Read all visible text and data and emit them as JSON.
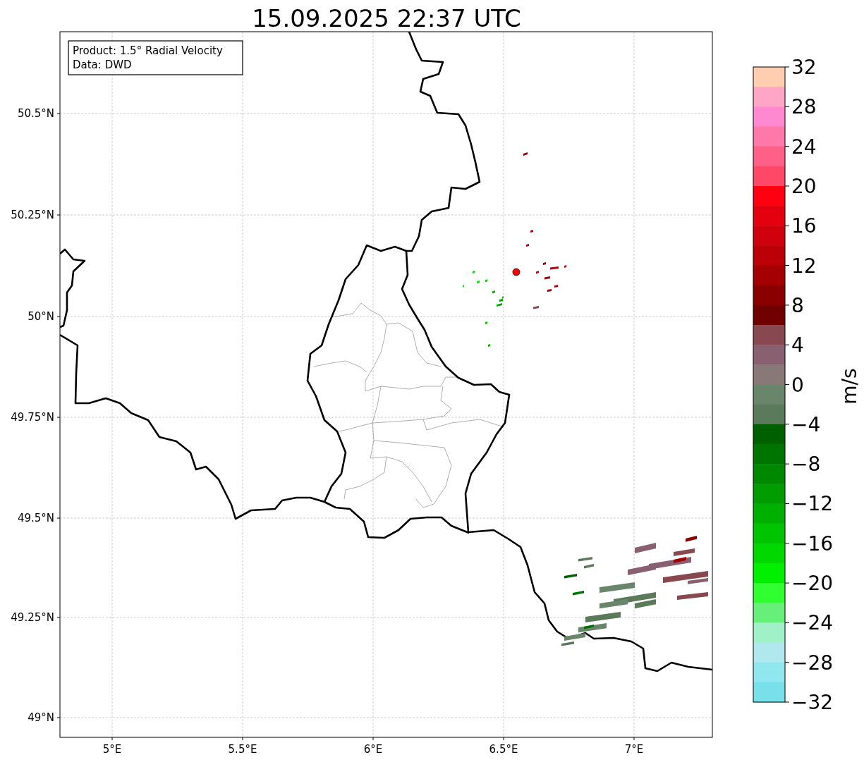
{
  "title": "15.09.2025 22:37 UTC",
  "legend": [
    "Product: 1.5° Radial Velocity",
    "Data: DWD"
  ],
  "y_ticks": [
    "50.5°N",
    "50.25°N",
    "50°N",
    "49.75°N",
    "49.5°N",
    "49.25°N",
    "49°N"
  ],
  "x_ticks": [
    "5°E",
    "5.5°E",
    "6°E",
    "6.5°E",
    "7°E"
  ],
  "colorbar": {
    "label": "m/s",
    "ticks": [
      "32",
      "28",
      "24",
      "20",
      "16",
      "12",
      "8",
      "4",
      "0",
      "−4",
      "−8",
      "−12",
      "−16",
      "−20",
      "−24",
      "−28",
      "−32"
    ],
    "bands": [
      {
        "color": "#ffcdb0"
      },
      {
        "color": "#ffa6c6"
      },
      {
        "color": "#ff88d0"
      },
      {
        "color": "#ff78a8"
      },
      {
        "color": "#ff6088"
      },
      {
        "color": "#ff4868"
      },
      {
        "color": "#ff0010"
      },
      {
        "color": "#e4000e"
      },
      {
        "color": "#d0000c"
      },
      {
        "color": "#bc0008"
      },
      {
        "color": "#a40004"
      },
      {
        "color": "#8a0000"
      },
      {
        "color": "#700000"
      },
      {
        "color": "#884850"
      },
      {
        "color": "#886070"
      },
      {
        "color": "#887878"
      },
      {
        "color": "#6a866a"
      },
      {
        "color": "#5a7a5a"
      },
      {
        "color": "#006000"
      },
      {
        "color": "#007400"
      },
      {
        "color": "#008800"
      },
      {
        "color": "#009c00"
      },
      {
        "color": "#00b000"
      },
      {
        "color": "#00c400"
      },
      {
        "color": "#00d800"
      },
      {
        "color": "#00f000"
      },
      {
        "color": "#30ff30"
      },
      {
        "color": "#66f07a"
      },
      {
        "color": "#a0f0c8"
      },
      {
        "color": "#b0e8ee"
      },
      {
        "color": "#90e8ee"
      },
      {
        "color": "#78e0e8"
      }
    ]
  }
}
